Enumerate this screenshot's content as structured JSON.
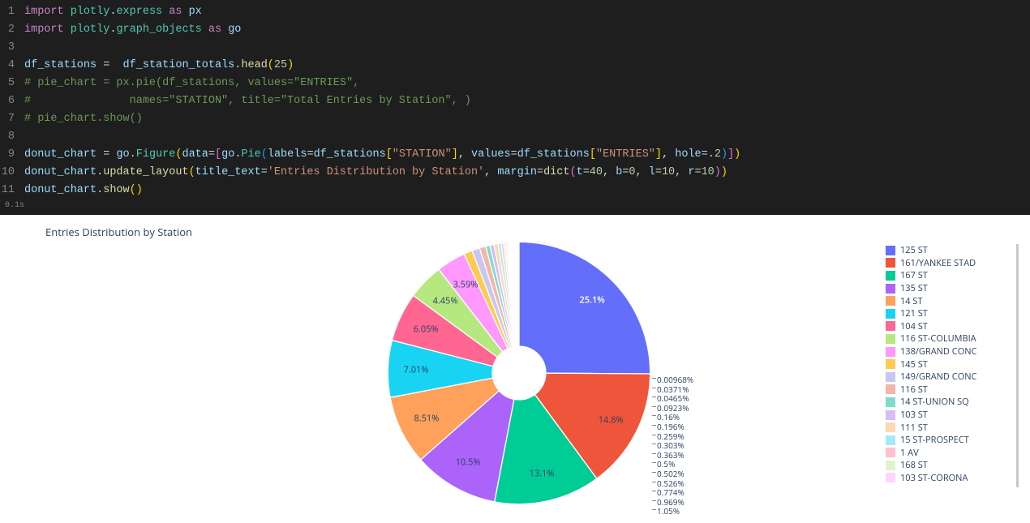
{
  "code": {
    "lines": [
      {
        "n": "1",
        "tokens": [
          {
            "c": "kw-import",
            "t": "import"
          },
          {
            "c": "",
            "t": " "
          },
          {
            "c": "kw-mod",
            "t": "plotly"
          },
          {
            "c": "",
            "t": "."
          },
          {
            "c": "kw-mod",
            "t": "express"
          },
          {
            "c": "",
            "t": " "
          },
          {
            "c": "kw-as",
            "t": "as"
          },
          {
            "c": "",
            "t": " "
          },
          {
            "c": "kw-var",
            "t": "px"
          }
        ]
      },
      {
        "n": "2",
        "tokens": [
          {
            "c": "kw-import",
            "t": "import"
          },
          {
            "c": "",
            "t": " "
          },
          {
            "c": "kw-mod",
            "t": "plotly"
          },
          {
            "c": "",
            "t": "."
          },
          {
            "c": "kw-mod",
            "t": "graph_objects"
          },
          {
            "c": "",
            "t": " "
          },
          {
            "c": "kw-as",
            "t": "as"
          },
          {
            "c": "",
            "t": " "
          },
          {
            "c": "kw-var",
            "t": "go"
          }
        ]
      },
      {
        "n": "3",
        "tokens": []
      },
      {
        "n": "4",
        "tokens": [
          {
            "c": "kw-var",
            "t": "df_stations"
          },
          {
            "c": "",
            "t": " "
          },
          {
            "c": "kw-op",
            "t": "="
          },
          {
            "c": "",
            "t": "  "
          },
          {
            "c": "kw-var",
            "t": "df_station_totals"
          },
          {
            "c": "",
            "t": "."
          },
          {
            "c": "kw-func",
            "t": "head"
          },
          {
            "c": "kw-paren",
            "t": "("
          },
          {
            "c": "kw-num",
            "t": "25"
          },
          {
            "c": "kw-paren",
            "t": ")"
          }
        ]
      },
      {
        "n": "5",
        "tokens": [
          {
            "c": "kw-comment",
            "t": "# pie_chart = px.pie(df_stations, values=\"ENTRIES\","
          }
        ]
      },
      {
        "n": "6",
        "tokens": [
          {
            "c": "kw-comment",
            "t": "#               names=\"STATION\", title=\"Total Entries by Station\", )"
          }
        ]
      },
      {
        "n": "7",
        "tokens": [
          {
            "c": "kw-comment",
            "t": "# pie_chart.show()"
          }
        ]
      },
      {
        "n": "8",
        "tokens": []
      },
      {
        "n": "9",
        "tokens": [
          {
            "c": "kw-var",
            "t": "donut_chart"
          },
          {
            "c": "",
            "t": " "
          },
          {
            "c": "kw-op",
            "t": "="
          },
          {
            "c": "",
            "t": " "
          },
          {
            "c": "kw-var",
            "t": "go"
          },
          {
            "c": "",
            "t": "."
          },
          {
            "c": "kw-class",
            "t": "Figure"
          },
          {
            "c": "kw-paren",
            "t": "("
          },
          {
            "c": "kw-prop",
            "t": "data"
          },
          {
            "c": "kw-op",
            "t": "="
          },
          {
            "c": "kw-paren2",
            "t": "["
          },
          {
            "c": "kw-var",
            "t": "go"
          },
          {
            "c": "",
            "t": "."
          },
          {
            "c": "kw-class",
            "t": "Pie"
          },
          {
            "c": "kw-paren3",
            "t": "("
          },
          {
            "c": "kw-prop",
            "t": "labels"
          },
          {
            "c": "kw-op",
            "t": "="
          },
          {
            "c": "kw-var",
            "t": "df_stations"
          },
          {
            "c": "kw-paren",
            "t": "["
          },
          {
            "c": "kw-str",
            "t": "\"STATION\""
          },
          {
            "c": "kw-paren",
            "t": "]"
          },
          {
            "c": "",
            "t": ", "
          },
          {
            "c": "kw-prop",
            "t": "values"
          },
          {
            "c": "kw-op",
            "t": "="
          },
          {
            "c": "kw-var",
            "t": "df_stations"
          },
          {
            "c": "kw-paren",
            "t": "["
          },
          {
            "c": "kw-str",
            "t": "\"ENTRIES\""
          },
          {
            "c": "kw-paren",
            "t": "]"
          },
          {
            "c": "",
            "t": ", "
          },
          {
            "c": "kw-prop",
            "t": "hole"
          },
          {
            "c": "kw-op",
            "t": "=."
          },
          {
            "c": "kw-num",
            "t": "2"
          },
          {
            "c": "kw-paren3",
            "t": ")"
          },
          {
            "c": "kw-paren2",
            "t": "]"
          },
          {
            "c": "kw-paren",
            "t": ")"
          }
        ]
      },
      {
        "n": "10",
        "tokens": [
          {
            "c": "kw-var",
            "t": "donut_chart"
          },
          {
            "c": "",
            "t": "."
          },
          {
            "c": "kw-func",
            "t": "update_layout"
          },
          {
            "c": "kw-paren",
            "t": "("
          },
          {
            "c": "kw-prop",
            "t": "title_text"
          },
          {
            "c": "kw-op",
            "t": "="
          },
          {
            "c": "kw-str",
            "t": "'Entries Distribution by Station'"
          },
          {
            "c": "",
            "t": ", "
          },
          {
            "c": "kw-prop",
            "t": "margin"
          },
          {
            "c": "kw-op",
            "t": "="
          },
          {
            "c": "kw-func",
            "t": "dict"
          },
          {
            "c": "kw-paren2",
            "t": "("
          },
          {
            "c": "kw-prop",
            "t": "t"
          },
          {
            "c": "kw-op",
            "t": "="
          },
          {
            "c": "kw-num",
            "t": "40"
          },
          {
            "c": "",
            "t": ", "
          },
          {
            "c": "kw-prop",
            "t": "b"
          },
          {
            "c": "kw-op",
            "t": "="
          },
          {
            "c": "kw-num",
            "t": "0"
          },
          {
            "c": "",
            "t": ", "
          },
          {
            "c": "kw-prop",
            "t": "l"
          },
          {
            "c": "kw-op",
            "t": "="
          },
          {
            "c": "kw-num",
            "t": "10"
          },
          {
            "c": "",
            "t": ", "
          },
          {
            "c": "kw-prop",
            "t": "r"
          },
          {
            "c": "kw-op",
            "t": "="
          },
          {
            "c": "kw-num",
            "t": "10"
          },
          {
            "c": "kw-paren2",
            "t": ")"
          },
          {
            "c": "kw-paren",
            "t": ")"
          }
        ]
      },
      {
        "n": "11",
        "tokens": [
          {
            "c": "kw-var",
            "t": "donut_chart"
          },
          {
            "c": "",
            "t": "."
          },
          {
            "c": "kw-func",
            "t": "show"
          },
          {
            "c": "kw-paren",
            "t": "("
          },
          {
            "c": "kw-paren",
            "t": ")"
          }
        ]
      }
    ],
    "exec_time": "0.1s"
  },
  "chart_data": {
    "type": "pie",
    "title": "Entries Distribution by Station",
    "hole": 0.2,
    "slices": [
      {
        "label": "125 ST",
        "pct": 25.1,
        "color": "#636efa",
        "pct_label": "25.1%"
      },
      {
        "label": "161/YANKEE STAD",
        "pct": 14.8,
        "color": "#ef553b",
        "pct_label": "14.8%"
      },
      {
        "label": "167 ST",
        "pct": 13.1,
        "color": "#00cc96",
        "pct_label": "13.1%"
      },
      {
        "label": "135 ST",
        "pct": 10.5,
        "color": "#ab63fa",
        "pct_label": "10.5%"
      },
      {
        "label": "14 ST",
        "pct": 8.51,
        "color": "#ffa15a",
        "pct_label": "8.51%"
      },
      {
        "label": "121 ST",
        "pct": 7.01,
        "color": "#19d3f3",
        "pct_label": "7.01%"
      },
      {
        "label": "104 ST",
        "pct": 6.05,
        "color": "#ff6692",
        "pct_label": "6.05%"
      },
      {
        "label": "116 ST-COLUMBIA",
        "pct": 4.45,
        "color": "#b6e880",
        "pct_label": "4.45%"
      },
      {
        "label": "138/GRAND CONC",
        "pct": 3.59,
        "color": "#ff97ff",
        "pct_label": "3.59%"
      },
      {
        "label": "145 ST",
        "pct": 1.05,
        "color": "#fecb52",
        "pct_label": "1.05%"
      },
      {
        "label": "149/GRAND CONC",
        "pct": 0.969,
        "color": "#c7c7f2",
        "pct_label": "0.969%"
      },
      {
        "label": "116 ST",
        "pct": 0.774,
        "color": "#f2b6a8",
        "pct_label": "0.774%"
      },
      {
        "label": "14 ST-UNION SQ",
        "pct": 0.526,
        "color": "#7edcc9",
        "pct_label": "0.526%"
      },
      {
        "label": "103 ST",
        "pct": 0.502,
        "color": "#d6bdf4",
        "pct_label": "0.502%"
      },
      {
        "label": "111 ST",
        "pct": 0.5,
        "color": "#ffd7b5",
        "pct_label": "0.5%"
      },
      {
        "label": "15 ST-PROSPECT",
        "pct": 0.363,
        "color": "#a6e8f7",
        "pct_label": "0.363%"
      },
      {
        "label": "1 AV",
        "pct": 0.303,
        "color": "#ffc1d1",
        "pct_label": "0.303%"
      },
      {
        "label": "168 ST",
        "pct": 0.259,
        "color": "#e0f4c7",
        "pct_label": "0.259%"
      },
      {
        "label": "103 ST-CORONA",
        "pct": 0.196,
        "color": "#ffd4ff",
        "pct_label": "0.196%"
      },
      {
        "label": null,
        "pct": 0.16,
        "color": "#fee9b0",
        "pct_label": "0.16%"
      },
      {
        "label": null,
        "pct": 0.0923,
        "color": "#636efa",
        "pct_label": "0.0923%"
      },
      {
        "label": null,
        "pct": 0.0465,
        "color": "#ef553b",
        "pct_label": "0.0465%"
      },
      {
        "label": null,
        "pct": 0.0371,
        "color": "#00cc96",
        "pct_label": "0.0371%"
      },
      {
        "label": null,
        "pct": 0.00968,
        "color": "#ab63fa",
        "pct_label": "0.00968%"
      }
    ],
    "tiny_labels_order": [
      "0.00968%",
      "0.0371%",
      "0.0465%",
      "0.0923%",
      "0.16%",
      "0.196%",
      "0.259%",
      "0.303%",
      "0.363%",
      "0.5%",
      "0.502%",
      "0.526%",
      "0.774%",
      "0.969%",
      "1.05%"
    ]
  }
}
